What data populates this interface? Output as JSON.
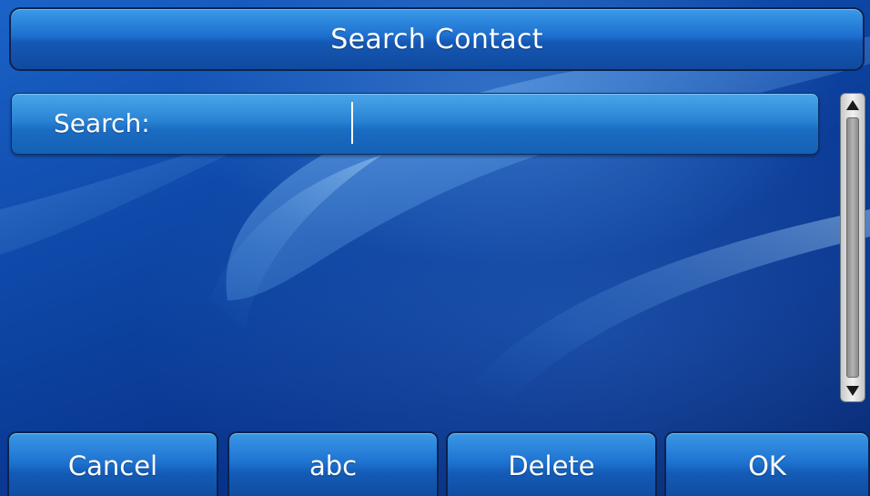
{
  "title_bar": {
    "title": "Search Contact"
  },
  "search": {
    "label": "Search:",
    "value": "",
    "placeholder": ""
  },
  "softkeys": [
    {
      "label": "Cancel"
    },
    {
      "label": "abc"
    },
    {
      "label": "Delete"
    },
    {
      "label": "OK"
    }
  ],
  "icons": {
    "scroll_up": "triangle-up-icon",
    "scroll_down": "triangle-down-icon"
  },
  "colors": {
    "background": "#0e48a8",
    "bar_accent": "#1d6fcf",
    "text": "#ffffff"
  }
}
